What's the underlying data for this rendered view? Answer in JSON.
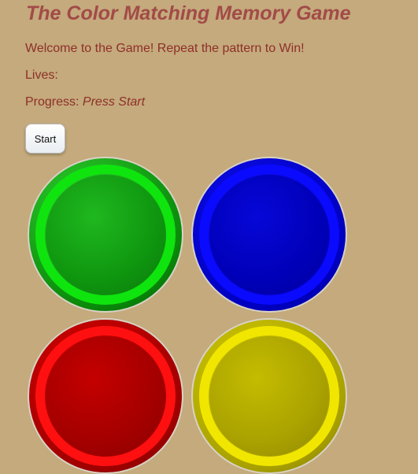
{
  "game": {
    "title": "The Color Matching Memory Game",
    "welcome": "Welcome to the Game! Repeat the pattern to Win!",
    "lives_label": "Lives:",
    "progress_label": "Progress:",
    "progress_value": "Press Start",
    "start_label": "Start"
  },
  "pads": [
    {
      "name": "green-pad",
      "color": "#0fe40f"
    },
    {
      "name": "blue-pad",
      "color": "#0a0aff"
    },
    {
      "name": "red-pad",
      "color": "#ff1010"
    },
    {
      "name": "yellow-pad",
      "color": "#f0e600"
    }
  ],
  "colors": {
    "background": "#c4aa7c",
    "title": "#a24b48",
    "text": "#8f2f2a"
  }
}
